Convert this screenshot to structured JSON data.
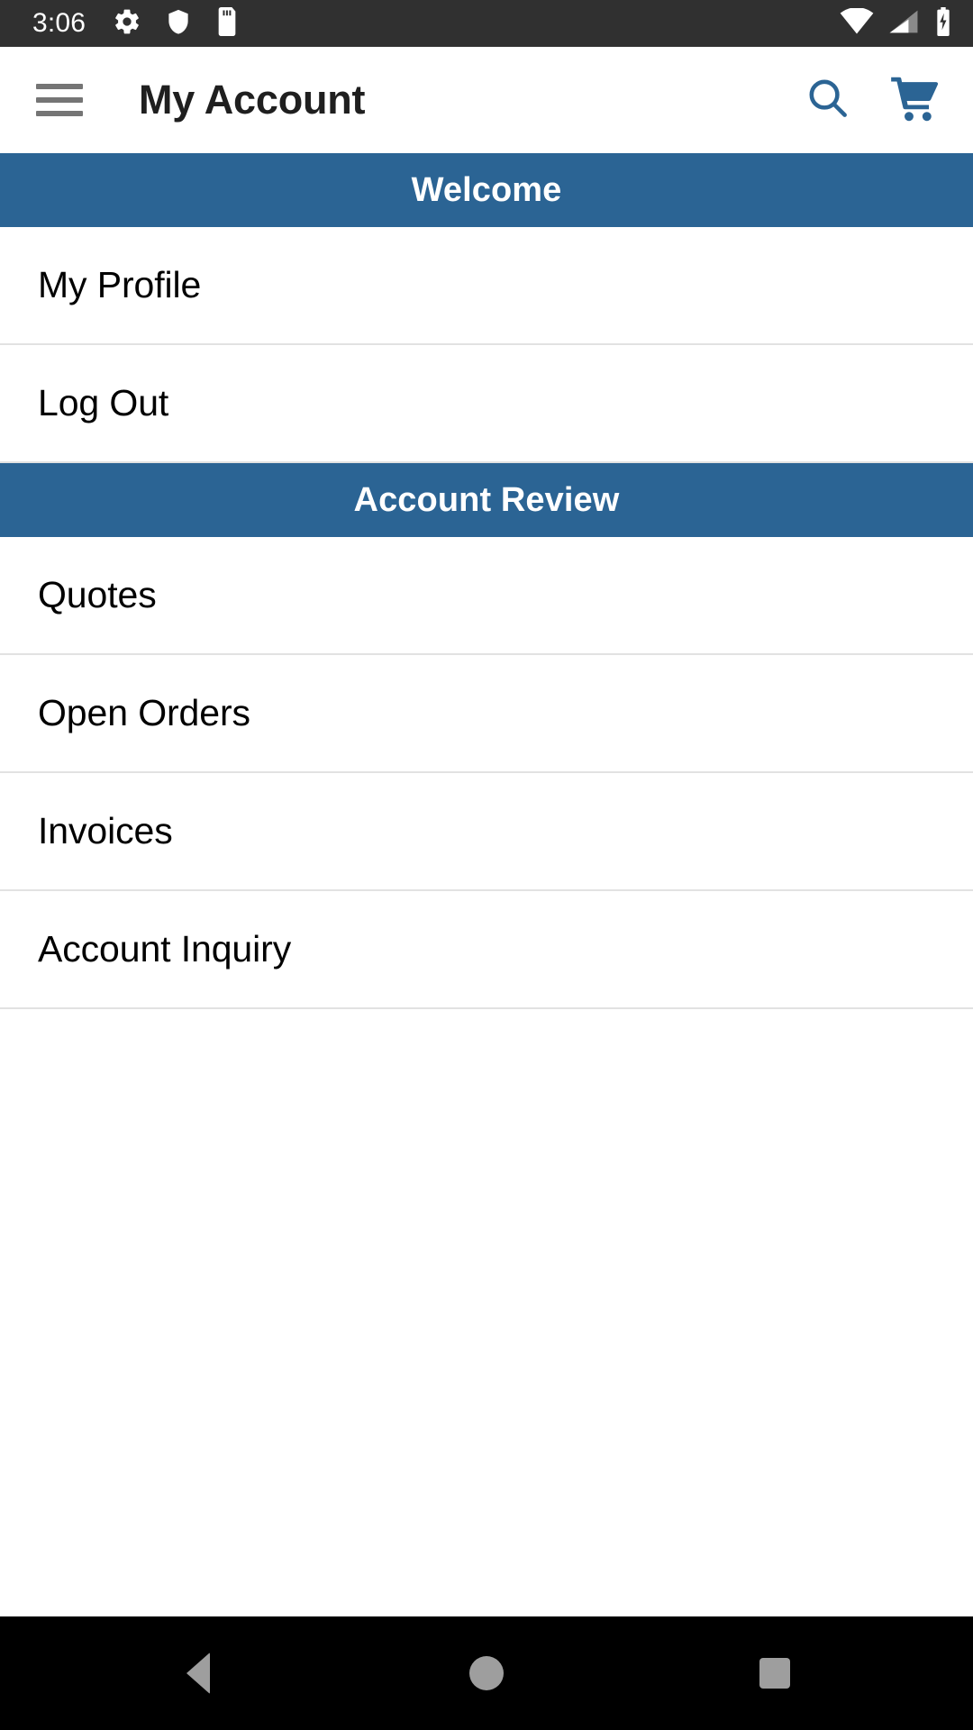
{
  "status_bar": {
    "time": "3:06",
    "left_icons": [
      "gear-icon",
      "shield-icon",
      "sd-card-icon"
    ],
    "right_icons": [
      "wifi-icon",
      "cellular-signal-icon",
      "battery-charging-icon"
    ],
    "background_color": "#303030",
    "foreground_color": "#ffffff"
  },
  "app_bar": {
    "menu_icon": "hamburger-menu-icon",
    "title": "My Account",
    "actions": [
      {
        "icon": "search-icon"
      },
      {
        "icon": "shopping-cart-icon"
      }
    ],
    "accent_color": "#2b6494",
    "background_color": "#ffffff"
  },
  "sections": [
    {
      "header": "Welcome",
      "items": [
        {
          "label": "My Profile"
        },
        {
          "label": "Log Out"
        }
      ]
    },
    {
      "header": "Account Review",
      "items": [
        {
          "label": "Quotes"
        },
        {
          "label": "Open Orders"
        },
        {
          "label": "Invoices"
        },
        {
          "label": "Account Inquiry"
        }
      ]
    }
  ],
  "nav_bar": {
    "background_color": "#000000",
    "icon_color": "#9e9e9e",
    "buttons": [
      {
        "icon": "back-triangle-icon"
      },
      {
        "icon": "home-circle-icon"
      },
      {
        "icon": "recents-square-icon"
      }
    ]
  },
  "theme": {
    "section_header_color": "#2b6494",
    "divider_color": "#e2e2e2",
    "text_color": "#000000"
  }
}
